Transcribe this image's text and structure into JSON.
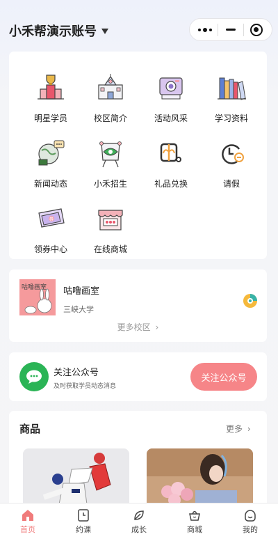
{
  "header": {
    "account_title": "小禾帮演示账号"
  },
  "grid": {
    "items": [
      {
        "label": "明星学员",
        "icon": "trophy-icon"
      },
      {
        "label": "校区简介",
        "icon": "school-building-icon"
      },
      {
        "label": "活动风采",
        "icon": "camera-icon"
      },
      {
        "label": "学习资料",
        "icon": "books-icon"
      },
      {
        "label": "新闻动态",
        "icon": "news-globe-icon"
      },
      {
        "label": "小禾招生",
        "icon": "enroll-board-icon"
      },
      {
        "label": "礼品兑换",
        "icon": "gift-icon"
      },
      {
        "label": "请假",
        "icon": "leave-clock-icon"
      },
      {
        "label": "领券中心",
        "icon": "coupon-icon"
      },
      {
        "label": "在线商城",
        "icon": "shop-icon"
      }
    ]
  },
  "campus": {
    "thumb_text": "咕噜画室",
    "name": "咕噜画室",
    "subtitle": "三峡大学",
    "more_label": "更多校区"
  },
  "follow": {
    "title": "关注公众号",
    "subtitle": "及时获取学员动态消息",
    "button_label": "关注公众号"
  },
  "goods": {
    "title": "商品",
    "more_label": "更多"
  },
  "tabbar": {
    "tabs": [
      {
        "label": "首页",
        "icon": "home-icon",
        "active": true
      },
      {
        "label": "约课",
        "icon": "clock-book-icon",
        "active": false
      },
      {
        "label": "成长",
        "icon": "leaf-icon",
        "active": false
      },
      {
        "label": "商城",
        "icon": "basket-icon",
        "active": false
      },
      {
        "label": "我的",
        "icon": "face-icon",
        "active": false
      }
    ]
  },
  "colors": {
    "accent": "#f68588",
    "wechat_green": "#2bb456",
    "active_tab": "#f07b7b"
  }
}
